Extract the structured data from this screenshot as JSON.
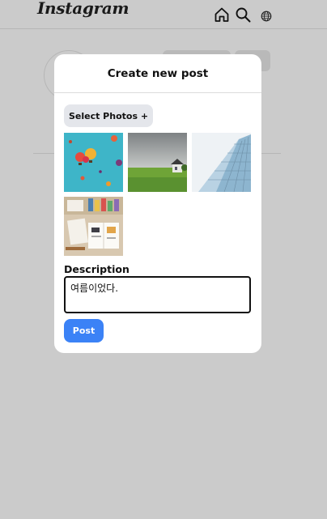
{
  "app": {
    "logo_text": "Instagram"
  },
  "nav": {
    "icons": [
      "home-icon",
      "search-icon",
      "globe-icon"
    ]
  },
  "modal": {
    "title": "Create new post",
    "select_photos_label": "Select Photos +",
    "photos": [
      {
        "subject": "hot-air-balloons"
      },
      {
        "subject": "house-on-green-field"
      },
      {
        "subject": "glass-building"
      },
      {
        "subject": "desk-with-notebook"
      }
    ],
    "description_label": "Description",
    "description_value": "여름이었다.",
    "post_label": "Post"
  },
  "colors": {
    "overlay_background": "#cbcbcb",
    "primary_button": "#3b82f6",
    "secondary_button": "#e4e6eb"
  }
}
